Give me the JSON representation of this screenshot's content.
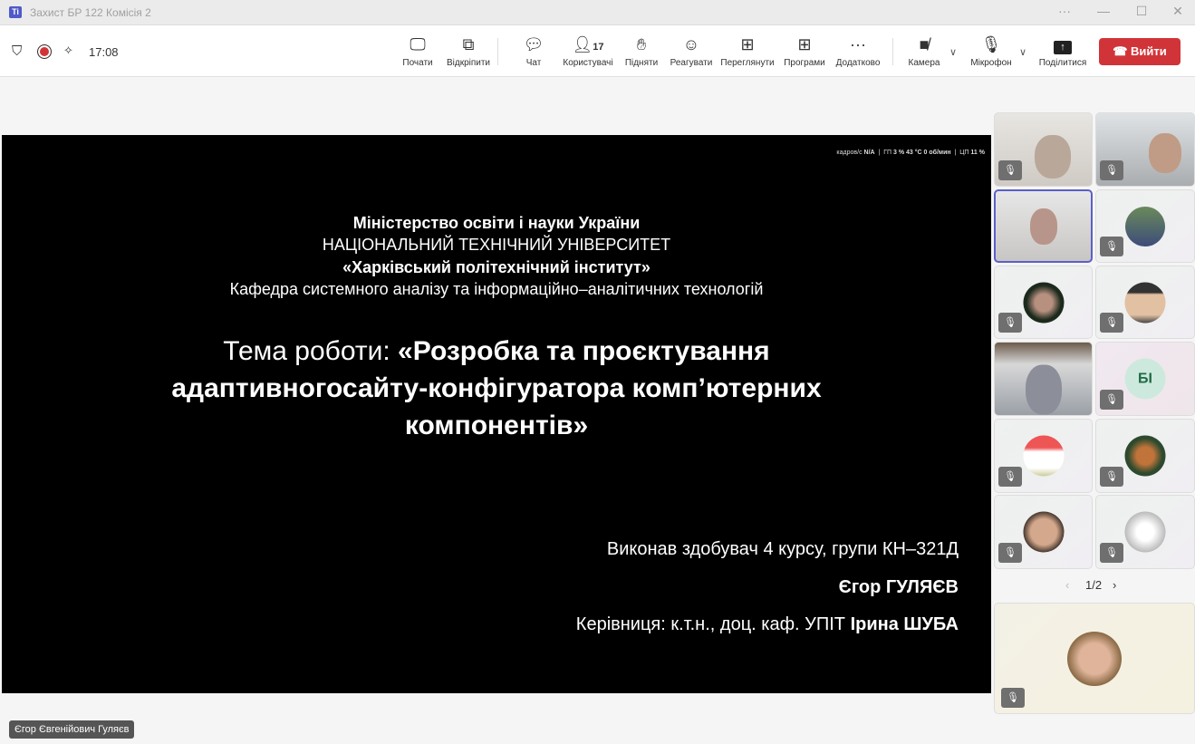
{
  "window": {
    "title": "Захист БР 122 Комісія 2",
    "app_icon": "Ti",
    "more": "···",
    "minimize": "—",
    "maximize": "☐",
    "close": "✕"
  },
  "header": {
    "time": "17:08"
  },
  "toolbar": {
    "start": "Почати",
    "unpin": "Відкріпити",
    "chat": "Чат",
    "people": "Користувачі",
    "people_count": "17",
    "raise": "Підняти",
    "react": "Реагувати",
    "view": "Переглянути",
    "apps": "Програми",
    "more": "Додатково",
    "camera": "Камера",
    "mic": "Мікрофон",
    "share": "Поділитися",
    "leave": "Вийти"
  },
  "slide": {
    "stats": {
      "fps_label": "кадров/с",
      "fps": "N/A",
      "gpu_label": "ГП",
      "gpu": "3 %",
      "temp": "43 °C",
      "rpm": "0 об/мин",
      "cpu_label": "ЦП",
      "cpu": "11 %"
    },
    "ministry": "Міністерство освіти і науки України",
    "university": "НАЦІОНАЛЬНИЙ ТЕХНІЧНИЙ УНІВЕРСИТЕТ",
    "institute": "«Харківський політехнічний інститут»",
    "department": "Кафедра системного аналізу та інформаційно–аналітичних технологій",
    "topic_label": "Тема роботи: ",
    "topic_1": "«Розробка та проєктування",
    "topic_2": "адаптивногосайту-конфігуратора комп’ютерних",
    "topic_3": "компонентів»",
    "author_line": "Виконав здобувач 4 курсу, групи КН–321Д",
    "author": "Єгор ГУЛЯЄВ",
    "supervisor_label": "Керівниця: к.т.н., доц. каф. УПІТ ",
    "supervisor": "Ірина ШУБА"
  },
  "presenter_name": "Єгор Євгенійович Гуляєв",
  "participants": {
    "initials_tile": "БІ",
    "page": "1/2"
  }
}
